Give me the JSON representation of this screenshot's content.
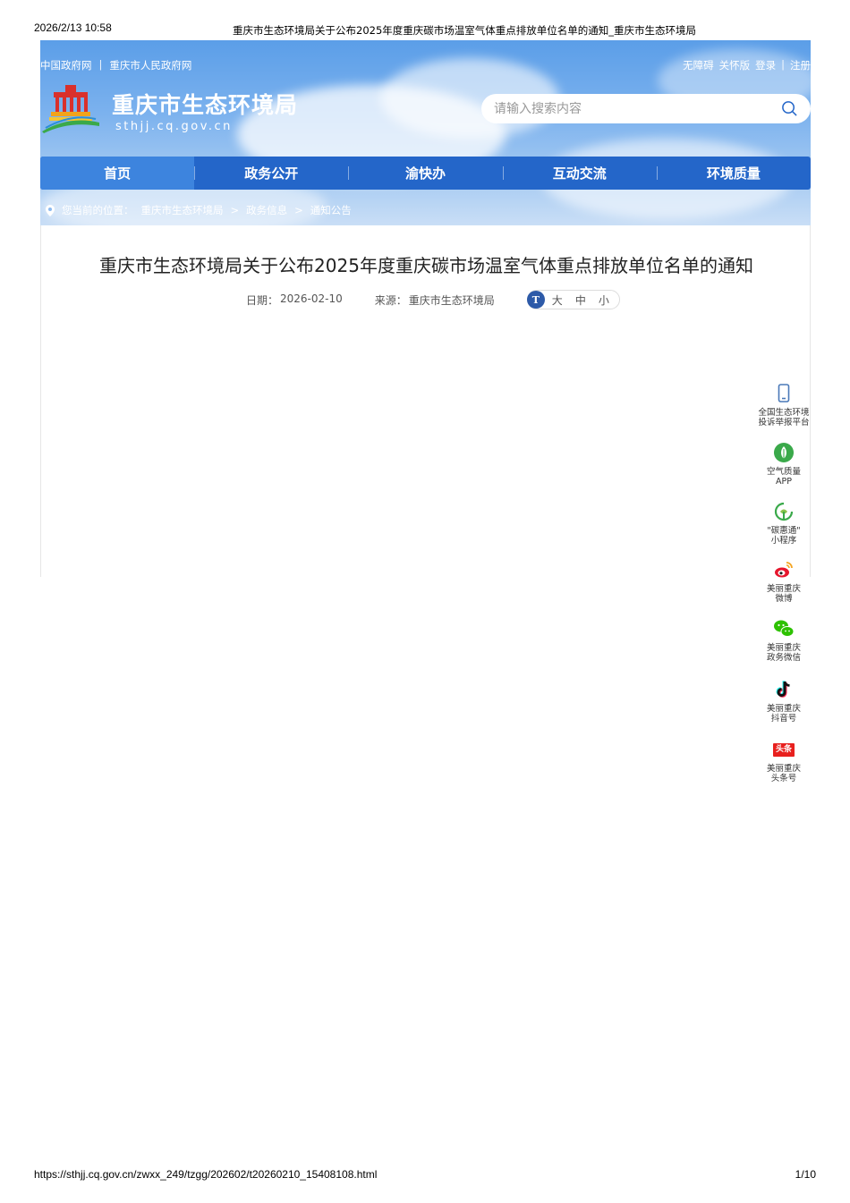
{
  "print_header": {
    "timestamp": "2026/2/13 10:58",
    "doc_title": "重庆市生态环境局关于公布2025年度重庆碳市场温室气体重点排放单位名单的通知_重庆市生态环境局"
  },
  "topbar": {
    "left_links": [
      "中国政府网",
      "重庆市人民政府网"
    ],
    "separator": "|",
    "right_links": [
      "无障碍",
      "关怀版",
      "登录",
      "注册"
    ]
  },
  "site": {
    "name": "重庆市生态环境局",
    "domain": "sthjj.cq.gov.cn"
  },
  "search": {
    "placeholder": "请输入搜索内容"
  },
  "nav": {
    "items": [
      "首页",
      "政务公开",
      "渝快办",
      "互动交流",
      "环境质量"
    ]
  },
  "breadcrumb": {
    "label": "您当前的位置：",
    "items": [
      "重庆市生态环境局",
      "政务信息",
      "通知公告"
    ],
    "separator": ">"
  },
  "article": {
    "title": "重庆市生态环境局关于公布2025年度重庆碳市场温室气体重点排放单位名单的通知",
    "date_label": "日期：",
    "date": "2026-02-10",
    "source_label": "来源：",
    "source": "重庆市生态环境局",
    "font_sizes": [
      "大",
      "中",
      "小"
    ]
  },
  "side_panel": [
    {
      "line1": "全国生态环境",
      "line2": "投诉举报平台",
      "icon": "phone-icon"
    },
    {
      "line1": "空气质量",
      "line2": "APP",
      "icon": "leaf-icon"
    },
    {
      "line1": "\"碳惠通\"",
      "line2": "小程序",
      "icon": "carbon-icon"
    },
    {
      "line1": "美丽重庆",
      "line2": "微博",
      "icon": "weibo-icon"
    },
    {
      "line1": "美丽重庆",
      "line2": "政务微信",
      "icon": "wechat-icon"
    },
    {
      "line1": "美丽重庆",
      "line2": "抖音号",
      "icon": "douyin-icon"
    },
    {
      "line1": "美丽重庆",
      "line2": "头条号",
      "icon": "toutiao-icon"
    }
  ],
  "toutiao_icon_text": "头条",
  "print_footer": {
    "url": "https://sthjj.cq.gov.cn/zwxx_249/tzgg/202602/t20260210_15408108.html",
    "page": "1/10"
  },
  "colors": {
    "nav_bg": "#2466c9",
    "nav_active": "#3d84de",
    "sky_top": "#5b9ee8"
  }
}
